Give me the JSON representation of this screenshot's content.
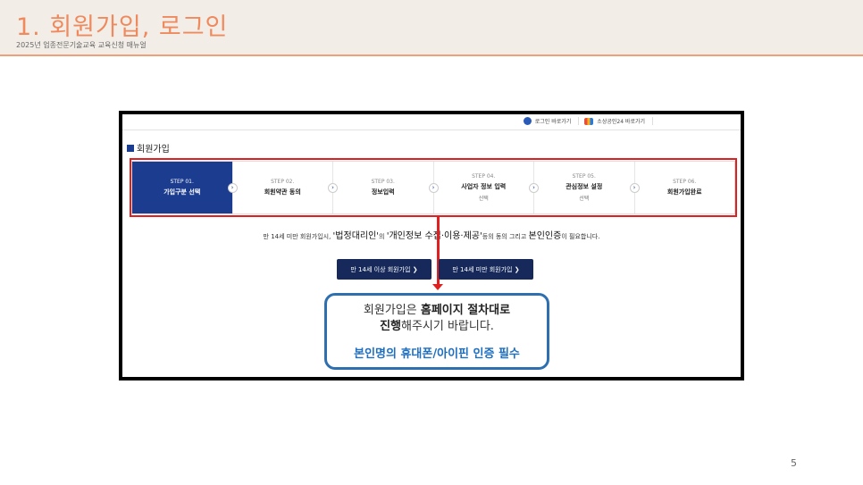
{
  "slide": {
    "title": "1. 회원가입, 로그인",
    "subtitle": "2025년 업종전문기술교육 교육신청 매뉴얼",
    "page_number": "5"
  },
  "topbar": {
    "link1": "로그인 바로가기",
    "link2": "소상공인24 바로가기"
  },
  "section_title": "회원가입",
  "steps": [
    {
      "num": "STEP 01.",
      "label": "가입구분 선택",
      "sub": ""
    },
    {
      "num": "STEP 02.",
      "label": "회원약관 동의",
      "sub": ""
    },
    {
      "num": "STEP 03.",
      "label": "정보입력",
      "sub": ""
    },
    {
      "num": "STEP 04.",
      "label": "사업자 정보 입력",
      "sub": "선택"
    },
    {
      "num": "STEP 05.",
      "label": "관심정보 설정",
      "sub": "선택"
    },
    {
      "num": "STEP 06.",
      "label": "회원가입완료",
      "sub": ""
    }
  ],
  "notice": {
    "pre": "만 14세 미만 회원가입시, ",
    "q1": "'법정대리인'",
    "mid1": "의 ",
    "q2": "'개인정보 수집·이용·제공'",
    "mid2": "등의 동의 그리고 ",
    "q3": "본인인증",
    "post": "이 필요합니다."
  },
  "buttons": {
    "over14": "만 14세 이상 회원가입 ❯",
    "under14": "만 14세 미만 회원가입 ❯"
  },
  "callout": {
    "line1_pre": "회원가입은 ",
    "line1_bold": "홈페이지 절차대로",
    "line2_bold": "진행",
    "line2_post": "해주시기 바랍니다.",
    "line3": "본인명의 휴대폰/아이핀 인증 필수"
  },
  "colors": {
    "accent": "#ef8a5e",
    "active_step": "#1c3d8f",
    "highlight_red": "#e02020",
    "callout_blue": "#2e6fb0"
  }
}
